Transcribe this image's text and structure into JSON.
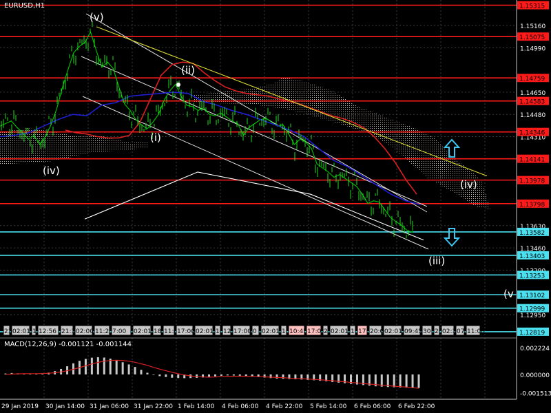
{
  "header": {
    "symbol_title": "EURUSD,H1"
  },
  "macd_panel": {
    "label": "MACD(12,26,9) -0.001121 -0.001144"
  },
  "chart_data": [
    {
      "type": "line",
      "title": "EURUSD,H1",
      "price_axis_ticks": [
        "1.15160",
        "1.14990",
        "1.14650",
        "1.14480",
        "1.14310",
        "1.13630",
        "1.13460",
        "1.13290",
        "1.12950"
      ],
      "horizontal_levels": {
        "red": [
          "1.15315",
          "1.15075",
          "1.14759",
          "1.14583",
          "1.14346",
          "1.14141",
          "1.13978",
          "1.13798"
        ],
        "cyan": [
          "1.13582",
          "1.13403",
          "1.13253",
          "1.13102",
          "1.12999",
          "1.12819"
        ]
      },
      "wave_labels": [
        "(v)",
        "(ii)",
        "(i)",
        "(iv)",
        "(iii)",
        "(iv)",
        "(v"
      ],
      "x_axis_labels": [
        "29 Jan 2019",
        "30 Jan 14:00",
        "31 Jan 06:00",
        "31 Jan 22:00",
        "1 Feb 14:00",
        "4 Feb 06:00",
        "4 Feb 22:00",
        "5 Feb 14:00",
        "6 Feb 06:00",
        "6 Feb 22:00"
      ],
      "time_boxes": [
        {
          "text": "23",
          "color": "#c8c8c8"
        },
        {
          "text": "02:01",
          "color": "#c8c8c8"
        },
        {
          "text": "1",
          "color": "#c8c8c8"
        },
        {
          "text": "12:56",
          "color": "#c8c8c8"
        },
        {
          "text": "21:3",
          "color": "#c8c8c8"
        },
        {
          "text": "02:00",
          "color": "#c8c8c8"
        },
        {
          "text": "11:25",
          "color": "#c8c8c8"
        },
        {
          "text": "7:00",
          "color": "#c8c8c8"
        },
        {
          "text": "02:01",
          "color": "#c8c8c8"
        },
        {
          "text": "18",
          "color": "#c8c8c8"
        },
        {
          "text": "11:00",
          "color": "#c8c8c8"
        },
        {
          "text": "17:00",
          "color": "#c8c8c8"
        },
        {
          "text": "02:01",
          "color": "#c8c8c8"
        },
        {
          "text": "1",
          "color": "#c8c8c8"
        },
        {
          "text": "12:0",
          "color": "#c8c8c8"
        },
        {
          "text": "17:00",
          "color": "#c8c8c8"
        },
        {
          "text": "0",
          "color": "#c8c8c8"
        },
        {
          "text": "02:01",
          "color": "#c8c8c8"
        },
        {
          "text": "1",
          "color": "#c8c8c8"
        },
        {
          "text": "10:45",
          "color": "#ffc0c0"
        },
        {
          "text": "17:01",
          "color": "#ffc0c0"
        },
        {
          "text": "2",
          "color": "#c8c8c8"
        },
        {
          "text": "02:01",
          "color": "#c8c8c8"
        },
        {
          "text": "1",
          "color": "#c8c8c8"
        },
        {
          "text": "17",
          "color": "#ffc0c0"
        },
        {
          "text": "20:0",
          "color": "#c8c8c8"
        },
        {
          "text": "02:01",
          "color": "#c8c8c8"
        },
        {
          "text": "09:45",
          "color": "#c8c8c8"
        },
        {
          "text": "30",
          "color": "#c8c8c8"
        },
        {
          "text": "2",
          "color": "#c8c8c8"
        },
        {
          "text": "02:3",
          "color": "#c8c8c8"
        },
        {
          "text": "07",
          "color": "#c8c8c8"
        },
        {
          "text": "11:00",
          "color": "#c8c8c8"
        }
      ],
      "series": [
        {
          "color": "#00c800",
          "values": [
            1.1439,
            1.1441,
            1.1443,
            1.1438,
            1.1434,
            1.1429,
            1.1432,
            1.1425,
            1.1431,
            1.144,
            1.1452,
            1.1468,
            1.1482,
            1.1495,
            1.15,
            1.1503,
            1.1511,
            1.1497,
            1.1484,
            1.1488,
            1.1483,
            1.1469,
            1.1456,
            1.1451,
            1.1444,
            1.144,
            1.1437,
            1.1442,
            1.1448,
            1.1459,
            1.1466,
            1.1471,
            1.1462,
            1.1455,
            1.1454,
            1.1451,
            1.1453,
            1.1448,
            1.1447,
            1.1449,
            1.1446,
            1.1443,
            1.1441,
            1.1432,
            1.1438,
            1.1441,
            1.1444,
            1.1445,
            1.1442,
            1.1439,
            1.144,
            1.1433,
            1.1425,
            1.1429,
            1.1427,
            1.1422,
            1.141,
            1.1407,
            1.1404,
            1.14,
            1.1402,
            1.1399,
            1.1396,
            1.1393,
            1.1387,
            1.138,
            1.1382,
            1.1381,
            1.1375,
            1.1369,
            1.1366,
            1.1363,
            1.1359,
            1.1358
          ]
        },
        {
          "color": "#dc2020",
          "values": [
            1.1436,
            1.1434,
            1.1433,
            1.1431,
            1.143,
            1.143,
            1.1432,
            1.1442,
            1.146,
            1.1478,
            1.1486,
            1.1488,
            1.1487,
            1.148,
            1.1474,
            1.1469,
            1.1466,
            1.1464,
            1.1463,
            1.1462,
            1.146,
            1.1458,
            1.1456,
            1.1453,
            1.145,
            1.1447,
            1.1445,
            1.1442,
            1.1438,
            1.1431,
            1.1422,
            1.1411,
            1.1398,
            1.1387
          ]
        },
        {
          "color": "#1e1ed2",
          "values": [
            1.1431,
            1.1432,
            1.1434,
            1.1439,
            1.1444,
            1.1448,
            1.1447,
            1.1455,
            1.1457,
            1.1462,
            1.1463,
            1.1464,
            1.1465,
            1.1464,
            1.1458,
            1.1455,
            1.1451,
            1.1448,
            1.1444,
            1.144,
            1.1436,
            1.1431,
            1.1422,
            1.1413,
            1.1408,
            1.1401,
            1.1394,
            1.1387,
            1.1382,
            1.1379
          ]
        },
        {
          "color": "#ffffff",
          "values": [
            1.1368,
            1.1404,
            1.1387,
            1.1352
          ]
        },
        {
          "color": "#dcdc32",
          "values": [
            1.1515,
            1.1401
          ]
        }
      ]
    },
    {
      "type": "bar",
      "title": "MACD(12,26,9) -0.001121 -0.001144",
      "y_axis_ticks": [
        "0.002224",
        "0.000000",
        "-0.001513"
      ],
      "ylim": [
        -0.001513,
        0.002224
      ],
      "histogram": [
        8e-05,
        0.00012,
        9e-05,
        7e-05,
        6e-05,
        6e-05,
        9e-05,
        0.00015,
        0.00028,
        0.00046,
        0.00068,
        0.00092,
        0.00113,
        0.00129,
        0.00139,
        0.00143,
        0.0014,
        0.00131,
        0.00118,
        0.00101,
        0.00083,
        0.00062,
        0.00038,
        0.00014,
        -4e-05,
        -0.00014,
        -0.00021,
        -0.00027,
        -0.0003,
        -0.00031,
        -0.0003,
        -0.00028,
        -0.00025,
        -0.00021,
        -0.00016,
        -0.00011,
        -8e-05,
        -9e-05,
        -0.00011,
        -0.00014,
        -0.00018,
        -0.00022,
        -0.00026,
        -0.0003,
        -0.00034,
        -0.00036,
        -0.00038,
        -0.0004,
        -0.00042,
        -0.00045,
        -0.00048,
        -0.00052,
        -0.00057,
        -0.00063,
        -0.00068,
        -0.00073,
        -0.00078,
        -0.00083,
        -0.00088,
        -0.00093,
        -0.00098,
        -0.00101,
        -0.00104,
        -0.00106,
        -0.00108,
        -0.0011,
        -0.00111,
        -0.00112
      ],
      "signal": [
        1e-05,
        3e-05,
        5e-05,
        6e-05,
        7e-05,
        7e-05,
        8e-05,
        0.0001,
        0.00014,
        0.00021,
        0.00031,
        0.00043,
        0.00057,
        0.00072,
        0.00087,
        0.001,
        0.0011,
        0.00116,
        0.00118,
        0.00116,
        0.0011,
        0.00101,
        0.00089,
        0.00075,
        0.00059,
        0.00044,
        0.00031,
        0.00018,
        6e-05,
        -4e-05,
        -0.00012,
        -0.00018,
        -0.00021,
        -0.00022,
        -0.00021,
        -0.00019,
        -0.00017,
        -0.00015,
        -0.00014,
        -0.00015,
        -0.00016,
        -0.00018,
        -0.0002,
        -0.00022,
        -0.00025,
        -0.00027,
        -0.0003,
        -0.00033,
        -0.00035,
        -0.00038,
        -0.00041,
        -0.00044,
        -0.00048,
        -0.00052,
        -0.00057,
        -0.00061,
        -0.00066,
        -0.0007,
        -0.00075,
        -0.0008,
        -0.00084,
        -0.00089,
        -0.00093,
        -0.00097,
        -0.00101,
        -0.00105,
        -0.0011,
        -0.00114
      ]
    }
  ]
}
